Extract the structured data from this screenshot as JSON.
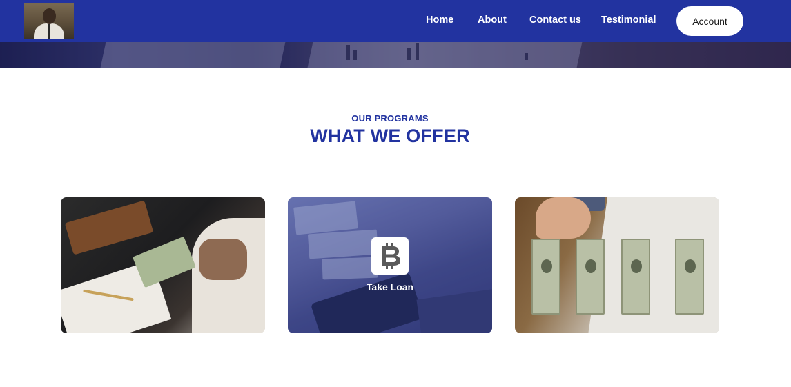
{
  "nav": {
    "links": [
      "Home",
      "About",
      "Contact us",
      "Testimonial"
    ],
    "account_label": "Account"
  },
  "section": {
    "eyebrow": "OUR PROGRAMS",
    "title": "WHAT WE OFFER"
  },
  "cards": [
    {
      "label": ""
    },
    {
      "label": "Take Loan",
      "icon": "bitcoin-icon"
    },
    {
      "label": ""
    }
  ],
  "colors": {
    "brand": "#2233a0",
    "button_bg": "#ffffff",
    "page_bg": "#ffffff"
  }
}
